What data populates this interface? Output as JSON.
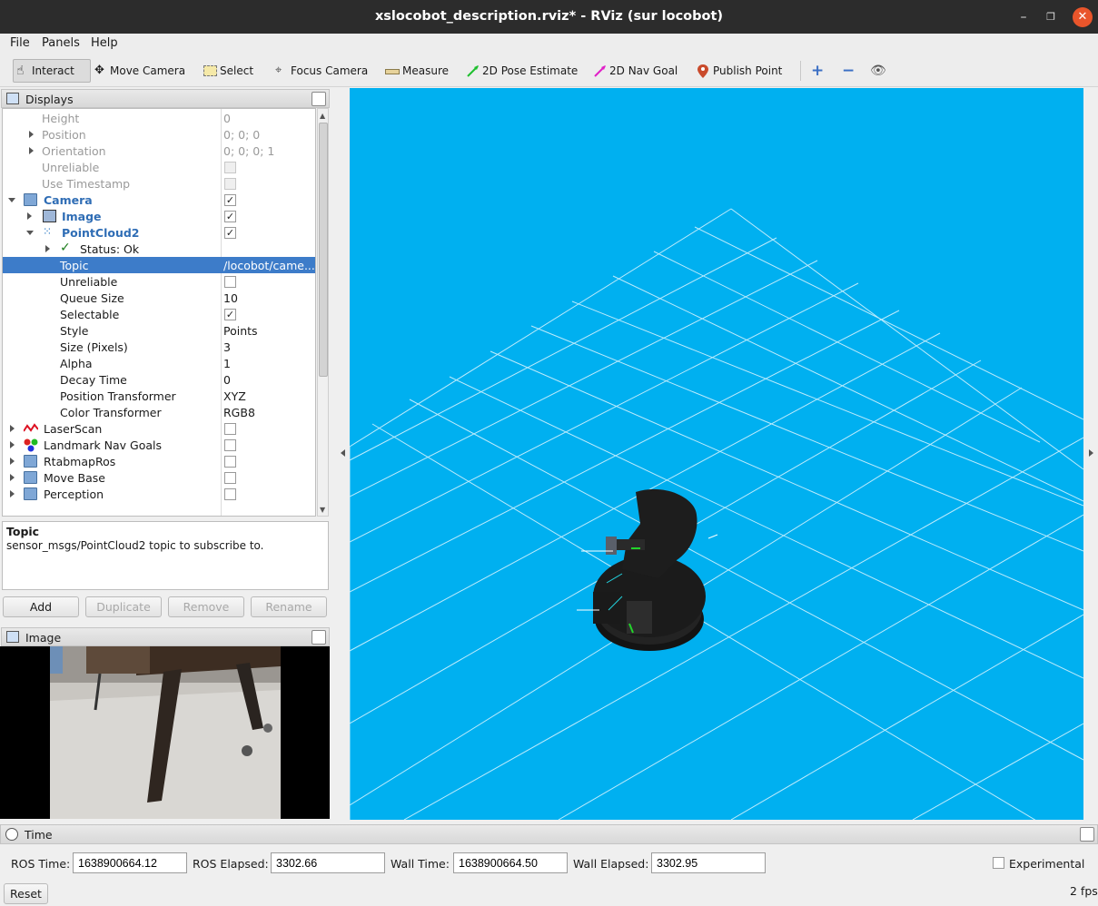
{
  "window": {
    "title": "xslocobot_description.rviz* - RViz (sur locobot)"
  },
  "menu": [
    "File",
    "Panels",
    "Help"
  ],
  "toolbar": {
    "interact": "Interact",
    "move_camera": "Move Camera",
    "select": "Select",
    "focus_camera": "Focus Camera",
    "measure": "Measure",
    "pose_estimate": "2D Pose Estimate",
    "nav_goal": "2D Nav Goal",
    "publish_point": "Publish Point"
  },
  "displays": {
    "title": "Displays",
    "rows": [
      {
        "label": "Height",
        "value": "0"
      },
      {
        "label": "Position",
        "value": "0; 0; 0"
      },
      {
        "label": "Orientation",
        "value": "0; 0; 0; 1"
      },
      {
        "label": "Unreliable",
        "value": ""
      },
      {
        "label": "Use Timestamp",
        "value": ""
      },
      {
        "label": "Camera",
        "value": ""
      },
      {
        "label": "Image",
        "value": ""
      },
      {
        "label": "PointCloud2",
        "value": ""
      },
      {
        "label": "Status: Ok",
        "value": ""
      },
      {
        "label": "Topic",
        "value": "/locobot/came..."
      },
      {
        "label": "Unreliable",
        "value": ""
      },
      {
        "label": "Queue Size",
        "value": "10"
      },
      {
        "label": "Selectable",
        "value": ""
      },
      {
        "label": "Style",
        "value": "Points"
      },
      {
        "label": "Size (Pixels)",
        "value": "3"
      },
      {
        "label": "Alpha",
        "value": "1"
      },
      {
        "label": "Decay Time",
        "value": "0"
      },
      {
        "label": "Position Transformer",
        "value": "XYZ"
      },
      {
        "label": "Color Transformer",
        "value": "RGB8"
      },
      {
        "label": "LaserScan",
        "value": ""
      },
      {
        "label": "Landmark Nav Goals",
        "value": ""
      },
      {
        "label": "RtabmapRos",
        "value": ""
      },
      {
        "label": "Move Base",
        "value": ""
      },
      {
        "label": "Perception",
        "value": ""
      }
    ],
    "desc_title": "Topic",
    "desc_text": "sensor_msgs/PointCloud2 topic to subscribe to.",
    "buttons": {
      "add": "Add",
      "duplicate": "Duplicate",
      "remove": "Remove",
      "rename": "Rename"
    }
  },
  "image_panel": {
    "title": "Image"
  },
  "time": {
    "title": "Time",
    "ros_time_label": "ROS Time:",
    "ros_time": "1638900664.12",
    "ros_elapsed_label": "ROS Elapsed:",
    "ros_elapsed": "3302.66",
    "wall_time_label": "Wall Time:",
    "wall_time": "1638900664.50",
    "wall_elapsed_label": "Wall Elapsed:",
    "wall_elapsed": "3302.95",
    "experimental": "Experimental",
    "reset": "Reset",
    "fps": "2 fps"
  },
  "colors": {
    "viewport_bg": "#00b0f0",
    "selection": "#3d7cc9",
    "accent_text": "#2f6db5"
  }
}
